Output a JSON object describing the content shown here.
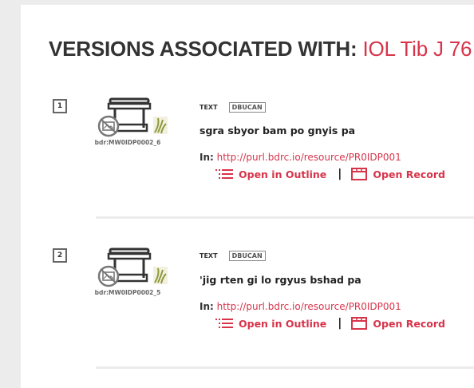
{
  "heading": {
    "prefix": "VERSIONS ASSOCIATED WITH:",
    "resource_id": "IOL Tib J 76"
  },
  "results": [
    {
      "number": "1",
      "thumbnail_caption": "bdr:MW0IDP0002_6",
      "type_tag": "TEXT",
      "source_tag": "DBUCAN",
      "title": "sgra sbyor bam po gnyis pa",
      "in_label": "In:",
      "in_link": "http://purl.bdrc.io/resource/PR0IDP001",
      "open_outline": "Open in Outline",
      "separator": "|",
      "open_record": "Open Record"
    },
    {
      "number": "2",
      "thumbnail_caption": "bdr:MW0IDP0002_5",
      "type_tag": "TEXT",
      "source_tag": "DBUCAN",
      "title": "'jig rten gi lo rgyus bshad pa",
      "in_label": "In:",
      "in_link": "http://purl.bdrc.io/resource/PR0IDP001",
      "open_outline": "Open in Outline",
      "separator": "|",
      "open_record": "Open Record"
    }
  ],
  "colors": {
    "accent": "#d7344a",
    "text": "#333333",
    "background": "#ececec"
  },
  "icons": {
    "thumbnail": "archive-box-icon",
    "no_image": "no-image-icon",
    "provider": "leaf-logo-icon",
    "outline": "outline-list-icon",
    "record": "record-calendar-icon"
  }
}
